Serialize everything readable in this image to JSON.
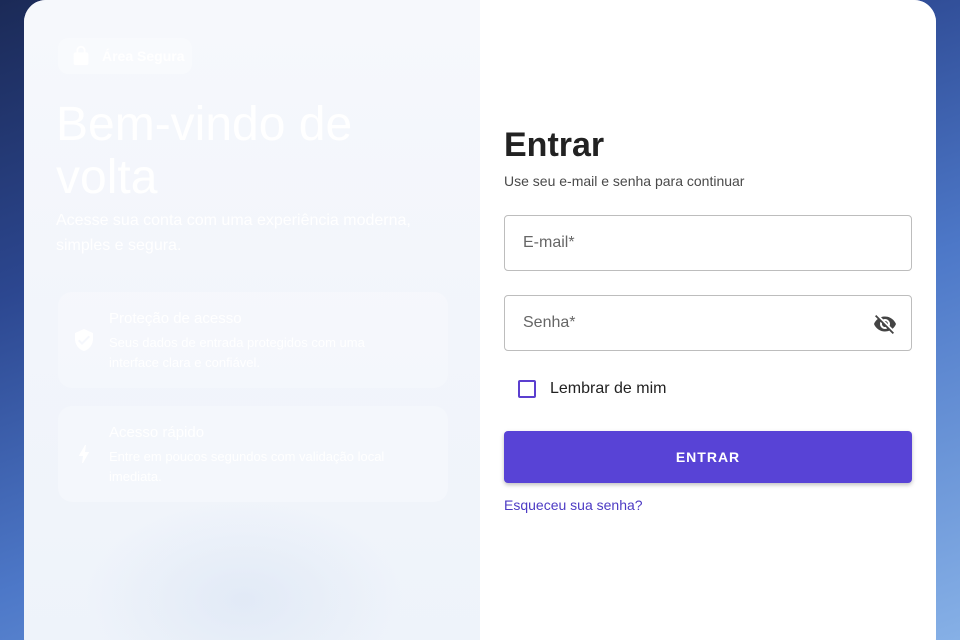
{
  "colors": {
    "accent": "#5843d6",
    "link": "#4d3bc4",
    "panel_bg": "#f4f6fb",
    "page_bg": "#2c4790"
  },
  "hero": {
    "badge_icon": "lock-icon",
    "badge": "Área Segura",
    "title": "Bem-vindo de volta",
    "subtitle": "Acesse sua conta com uma experiência moderna, simples e segura."
  },
  "features": [
    {
      "icon": "shield-check-icon",
      "title": "Proteção de acesso",
      "description": "Seus dados de entrada protegidos com uma interface clara e confiável."
    },
    {
      "icon": "bolt-icon",
      "title": "Acesso rápido",
      "description": "Entre em poucos segundos com validação local imediata."
    }
  ],
  "form": {
    "title": "Entrar",
    "subtitle": "Use seu e-mail e senha para continuar",
    "email": {
      "placeholder": "E-mail*",
      "value": ""
    },
    "password": {
      "placeholder": "Senha*",
      "value": "",
      "toggle_icon": "visibility-off-icon"
    },
    "remember_label": "Lembrar de mim",
    "remember_checked": false,
    "submit_label": "ENTRAR",
    "forgot_link": "Esqueceu sua senha?"
  }
}
